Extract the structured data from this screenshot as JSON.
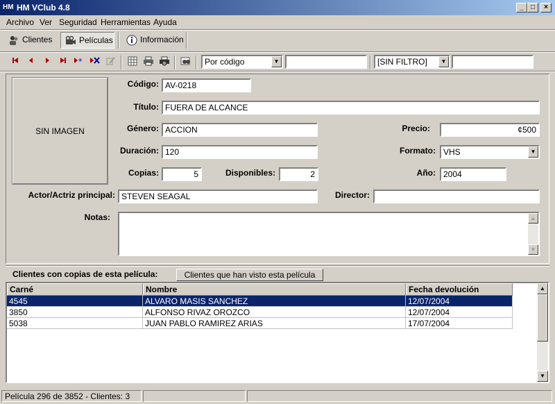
{
  "window": {
    "title": "HM VClub 4.8",
    "app_icon": "HM",
    "min_glyph": "_",
    "max_glyph": "□",
    "close_glyph": "×"
  },
  "menu": [
    {
      "label": "Archivo"
    },
    {
      "label": "Ver"
    },
    {
      "label": "Seguridad"
    },
    {
      "label": "Herramientas"
    },
    {
      "label": "Ayuda"
    }
  ],
  "modules": {
    "clientes": "Clientes",
    "peliculas": "Películas",
    "informacion": "Información"
  },
  "navbar": {
    "order_combo": "Por código",
    "order_search": "",
    "filter_combo": "[SIN FILTRO]",
    "filter_value": ""
  },
  "form": {
    "image_text": "SIN IMAGEN",
    "codigo_label": "Código:",
    "codigo": "AV-0218",
    "titulo_label": "Título:",
    "titulo": "FUERA DE ALCANCE",
    "genero_label": "Género:",
    "genero": "ACCION",
    "precio_label": "Precio:",
    "precio": "¢500",
    "duracion_label": "Duración:",
    "duracion": "120",
    "formato_label": "Formato:",
    "formato": "VHS",
    "copias_label": "Copias:",
    "copias": "5",
    "disponibles_label": "Disponibles:",
    "disponibles": "2",
    "anio_label": "Año:",
    "anio": "2004",
    "actor_label": "Actor/Actriz principal:",
    "actor": "STEVEN SEAGAL",
    "director_label": "Director:",
    "director": "",
    "notas_label": "Notas:",
    "notas": ""
  },
  "clients_section": {
    "label": "Clientes con copias de esta película:",
    "history_button": "Clientes que han visto esta película",
    "columns": [
      "Carné",
      "Nombre",
      "Fecha devolución"
    ],
    "rows": [
      [
        "4545",
        "ALVARO MASIS SANCHEZ",
        "12/07/2004"
      ],
      [
        "3850",
        "ALFONSO RIVAZ OROZCO",
        "12/07/2004"
      ],
      [
        "5038",
        "JUAN PABLO RAMIREZ ARIAS",
        "17/07/2004"
      ]
    ]
  },
  "status": {
    "text": "Película 296 de 3852 - Clientes: 3"
  },
  "colors": {
    "title_start": "#0a246a",
    "title_end": "#a6caf0",
    "selection": "#0a246a",
    "face": "#d4d0c8"
  }
}
